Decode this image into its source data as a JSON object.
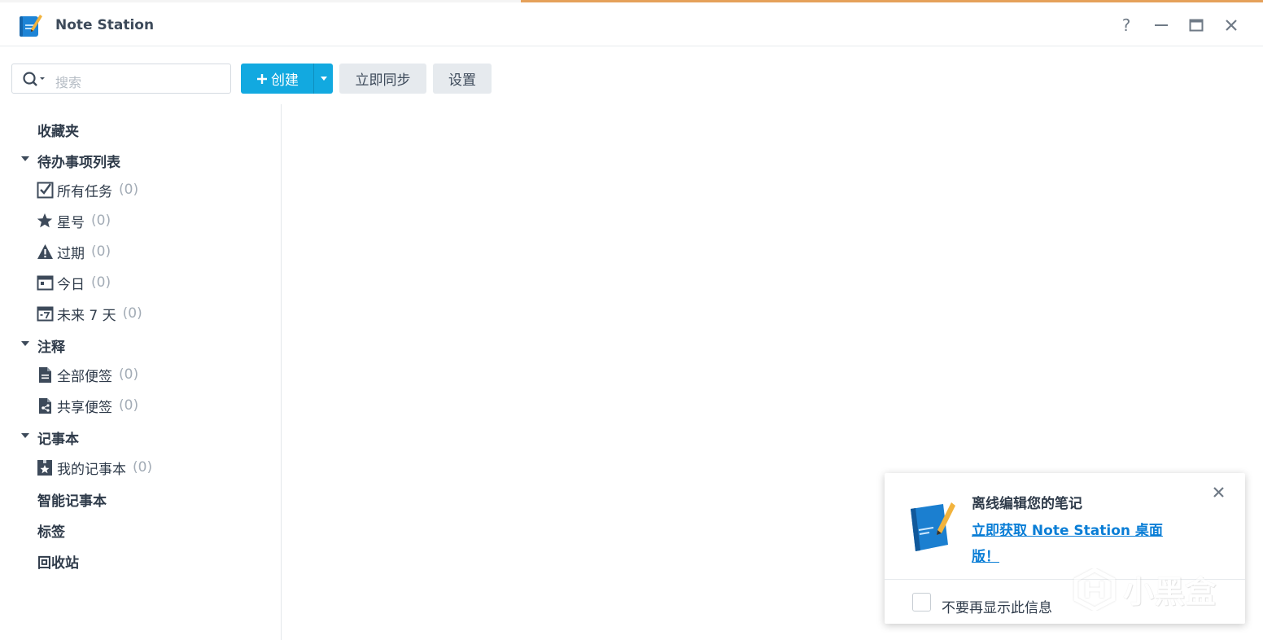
{
  "app": {
    "title": "Note Station"
  },
  "window_controls": {
    "help": "?",
    "minimize": "—",
    "close": "✕"
  },
  "toolbar": {
    "search_placeholder": "搜索",
    "create_label": "创建",
    "sync_label": "立即同步",
    "settings_label": "设置"
  },
  "sidebar": {
    "favorites": "收藏夹",
    "todo": {
      "header": "待办事项列表",
      "items": [
        {
          "label": "所有任务",
          "count": "(0)",
          "icon": "checkbox-icon"
        },
        {
          "label": "星号",
          "count": "(0)",
          "icon": "star-icon"
        },
        {
          "label": "过期",
          "count": "(0)",
          "icon": "warning-icon"
        },
        {
          "label": "今日",
          "count": "(0)",
          "icon": "calendar-today-icon"
        },
        {
          "label": "未来 7 天",
          "count": "(0)",
          "icon": "calendar-7days-icon"
        }
      ]
    },
    "notes": {
      "header": "注释",
      "items": [
        {
          "label": "全部便签",
          "count": "(0)",
          "icon": "note-icon"
        },
        {
          "label": "共享便签",
          "count": "(0)",
          "icon": "shared-note-icon"
        }
      ]
    },
    "notebooks": {
      "header": "记事本",
      "items": [
        {
          "label": "我的记事本",
          "count": "(0)",
          "icon": "notebook-star-icon"
        }
      ]
    },
    "smart_notebooks": "智能记事本",
    "tags": "标签",
    "recycle_bin": "回收站"
  },
  "popup": {
    "title": "离线编辑您的笔记",
    "link_line1": "立即获取 Note Station 桌面",
    "link_line2": "版！",
    "checkbox_label": "不要再显示此信息"
  },
  "watermark": {
    "text": "小黑盒"
  },
  "colors": {
    "accent": "#12a9e0",
    "link": "#0a7ed6",
    "text": "#2f3b4a",
    "muted": "#a3acb6"
  }
}
